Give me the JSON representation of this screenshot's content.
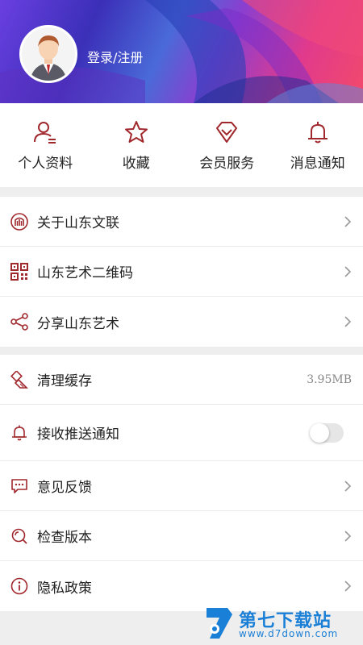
{
  "header": {
    "login_label": "登录/注册",
    "avatar_icon": "user-avatar"
  },
  "quick_actions": [
    {
      "label": "个人资料",
      "icon": "profile-icon"
    },
    {
      "label": "收藏",
      "icon": "star-icon"
    },
    {
      "label": "会员服务",
      "icon": "diamond-icon"
    },
    {
      "label": "消息通知",
      "icon": "bell-icon"
    }
  ],
  "menu_group1": [
    {
      "label": "关于山东文联",
      "icon": "logo-icon"
    },
    {
      "label": "山东艺术二维码",
      "icon": "qrcode-icon"
    },
    {
      "label": "分享山东艺术",
      "icon": "share-icon"
    }
  ],
  "menu_group2": {
    "clear_cache": {
      "label": "清理缓存",
      "value": "3.95MB",
      "icon": "broom-icon"
    },
    "push": {
      "label": "接收推送通知",
      "icon": "bell-icon",
      "enabled": false
    },
    "feedback": {
      "label": "意见反馈",
      "icon": "chat-icon"
    },
    "check_version": {
      "label": "检查版本",
      "icon": "search-icon"
    },
    "privacy": {
      "label": "隐私政策",
      "icon": "info-icon"
    }
  },
  "watermark": {
    "title": "第七下载站",
    "url": "www.d7down.com"
  },
  "colors": {
    "accent": "#a0282d",
    "watermark": "#1a7fd6"
  }
}
